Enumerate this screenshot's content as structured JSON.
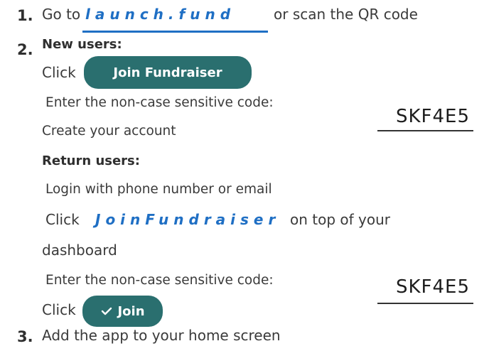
{
  "steps": {
    "n1": "1.",
    "n2": "2.",
    "n3": "3."
  },
  "step1": {
    "prefix": "Go to",
    "link": "launch.fund",
    "suffix": "or scan the QR code"
  },
  "new_users": {
    "heading": "New users:",
    "click_label": "Click",
    "button_label": "Join Fundraiser",
    "enter_code": "Enter the non-case sensitive code:",
    "create_account": "Create your account",
    "code": "SKF4E5"
  },
  "return_users": {
    "heading": "Return users:",
    "login": "Login with phone number or email",
    "click_label": "Click",
    "link": "JoinFundraiser",
    "link_suffix": "on top of your",
    "dashboard": "dashboard",
    "enter_code": "Enter the non-case sensitive code:",
    "click2": "Click",
    "join_label": "Join",
    "code": "SKF4E5"
  },
  "step3": {
    "text": "Add the app to your home screen"
  },
  "colors": {
    "link_blue": "#1f6fc4",
    "button_teal": "#2a6f6f"
  },
  "icons": {
    "check": "check-icon"
  }
}
